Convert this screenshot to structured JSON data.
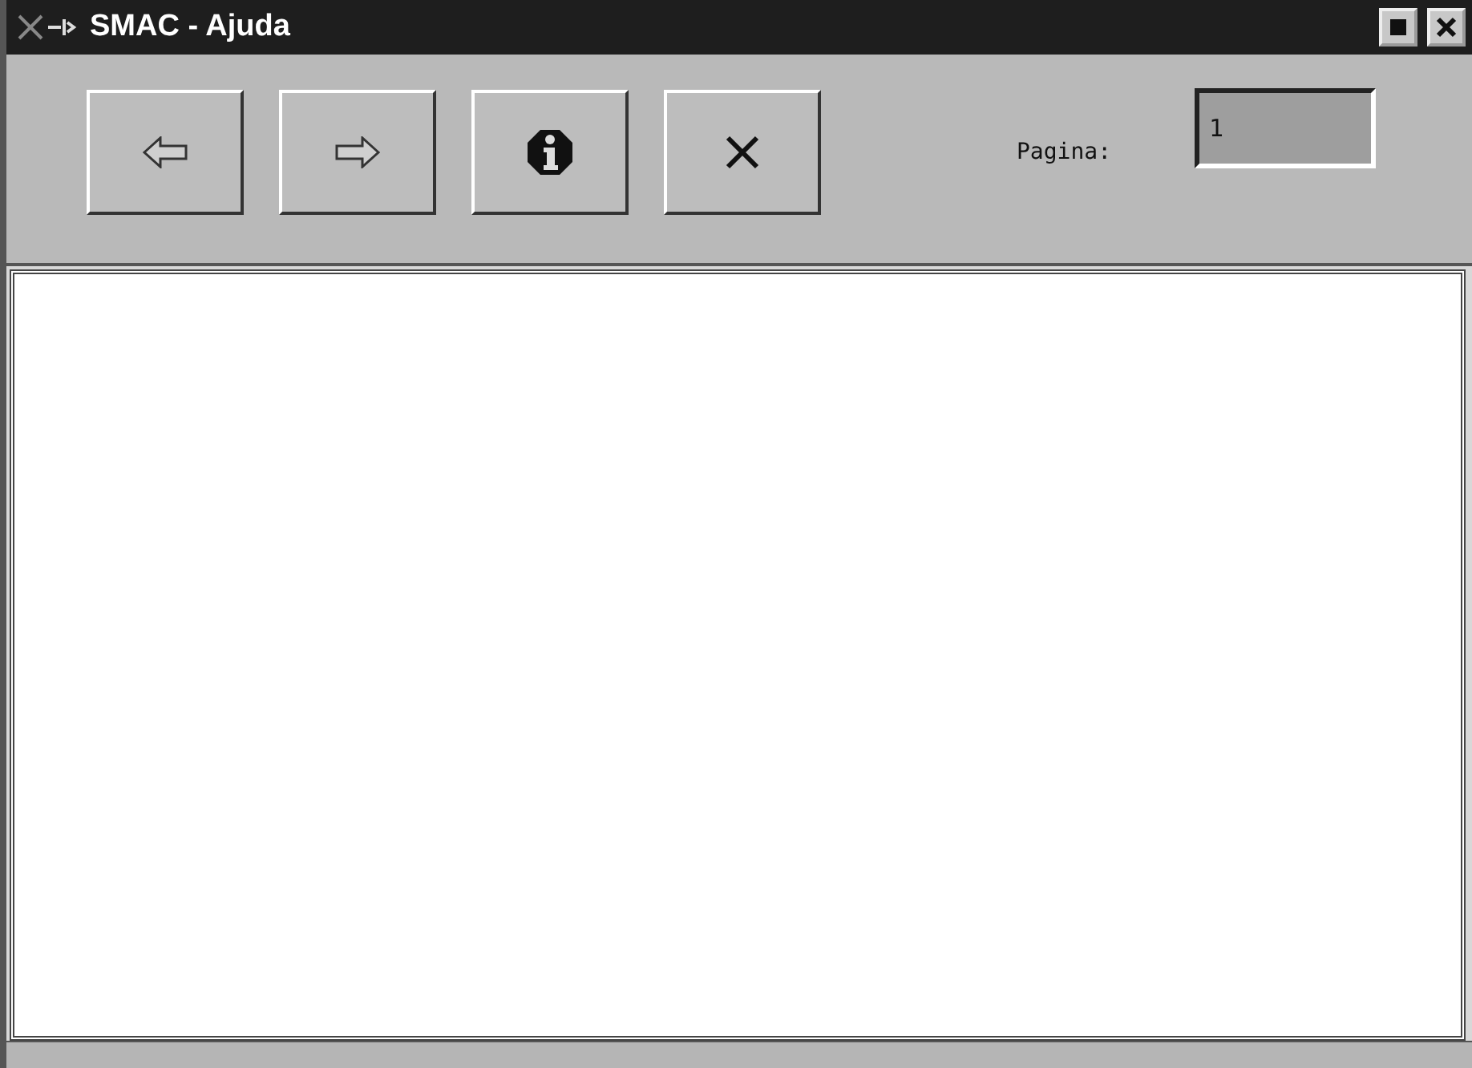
{
  "window": {
    "title": "SMAC - Ajuda"
  },
  "toolbar": {
    "buttons": [
      {
        "kind": "back"
      },
      {
        "kind": "forward"
      },
      {
        "kind": "info"
      },
      {
        "kind": "close"
      }
    ],
    "page_label": "Pagina:",
    "page_value": "1"
  }
}
